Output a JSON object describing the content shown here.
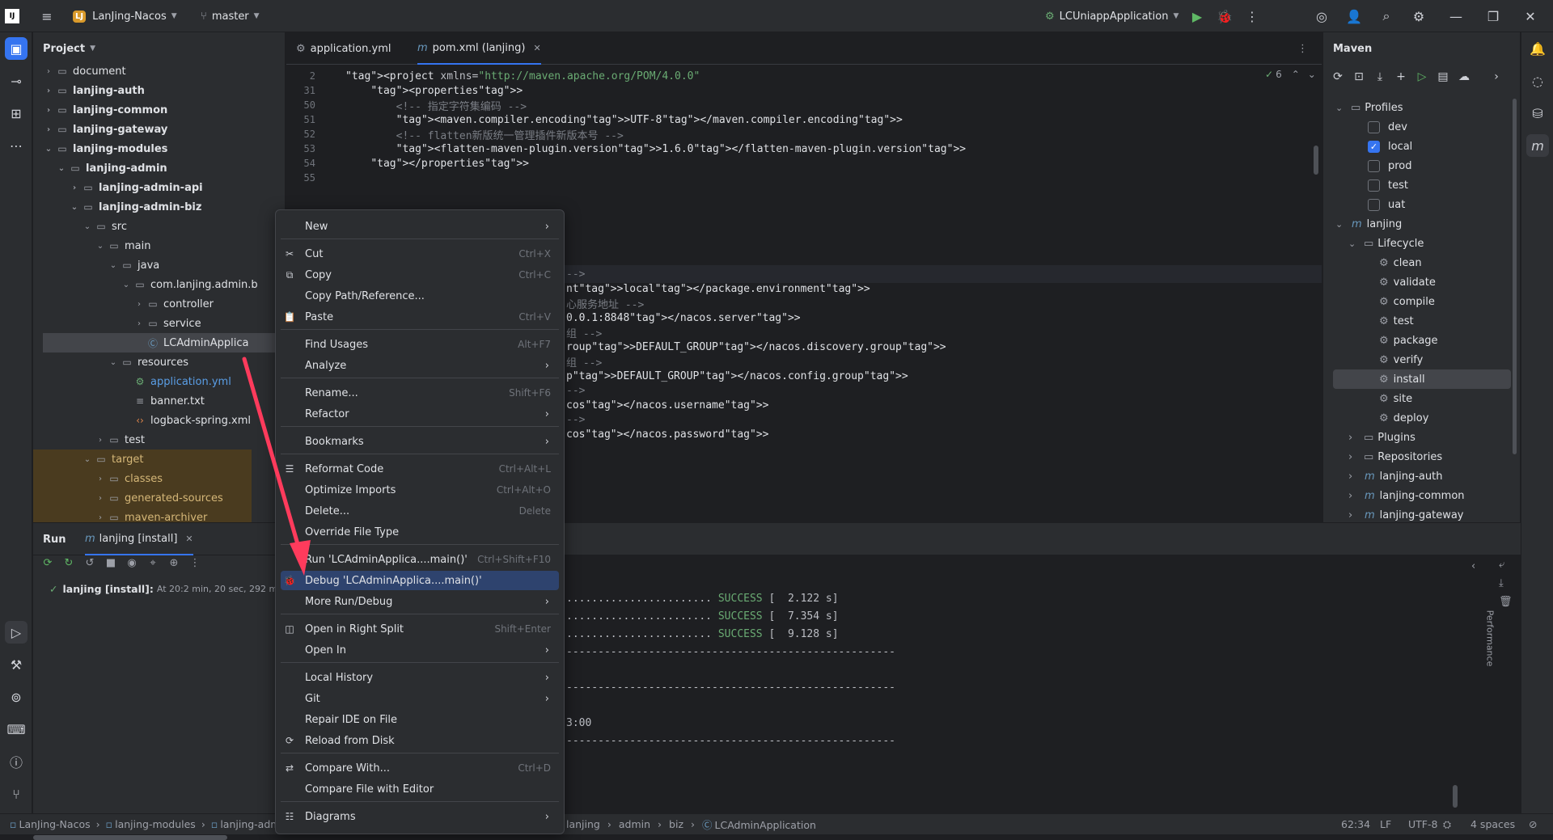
{
  "titlebar": {
    "project_badge": "LJ",
    "project": "LanJing-Nacos",
    "branch": "master",
    "run_config": "LCUniappApplication"
  },
  "project_panel": {
    "title": "Project",
    "tree": [
      {
        "label": "document",
        "bold": false,
        "icon": "folder"
      },
      {
        "label": "lanjing-auth",
        "bold": true,
        "icon": "module"
      },
      {
        "label": "lanjing-common",
        "bold": true,
        "icon": "module"
      },
      {
        "label": "lanjing-gateway",
        "bold": true,
        "icon": "module"
      },
      {
        "label": "lanjing-modules",
        "bold": true,
        "icon": "module"
      },
      {
        "label": "lanjing-admin",
        "bold": true,
        "icon": "module"
      },
      {
        "label": "lanjing-admin-api",
        "bold": true,
        "icon": "module"
      },
      {
        "label": "lanjing-admin-biz",
        "bold": true,
        "icon": "module"
      },
      {
        "label": "src",
        "bold": false,
        "icon": "folder"
      },
      {
        "label": "main",
        "bold": false,
        "icon": "folder"
      },
      {
        "label": "java",
        "bold": false,
        "icon": "folder"
      },
      {
        "label": "com.lanjing.admin.b",
        "bold": false,
        "icon": "package"
      },
      {
        "label": "controller",
        "bold": false,
        "icon": "package"
      },
      {
        "label": "service",
        "bold": false,
        "icon": "package"
      },
      {
        "label": "LCAdminApplica",
        "bold": false,
        "icon": "class"
      },
      {
        "label": "resources",
        "bold": false,
        "icon": "folder"
      },
      {
        "label": "application.yml",
        "bold": false,
        "icon": "yml"
      },
      {
        "label": "banner.txt",
        "bold": false,
        "icon": "text"
      },
      {
        "label": "logback-spring.xml",
        "bold": false,
        "icon": "xml"
      },
      {
        "label": "test",
        "bold": false,
        "icon": "folder"
      },
      {
        "label": "target",
        "bold": false,
        "icon": "folder"
      },
      {
        "label": "classes",
        "bold": false,
        "icon": "folder"
      },
      {
        "label": "generated-sources",
        "bold": false,
        "icon": "folder"
      },
      {
        "label": "maven-archiver",
        "bold": false,
        "icon": "folder"
      }
    ]
  },
  "editor": {
    "tabs": [
      {
        "label": "application.yml"
      },
      {
        "label": "pom.xml (lanjing)"
      }
    ],
    "inspections": "6",
    "lines": [
      {
        "n": "2",
        "t": "<project xmlns=\"http://maven.apache.org/POM/4.0.0\""
      },
      {
        "n": "31",
        "t": "    <properties>"
      },
      {
        "n": "50",
        "t": "        <!-- 指定字符集编码 -->"
      },
      {
        "n": "51",
        "t": "        <maven.compiler.encoding>UTF-8</maven.compiler.encoding>"
      },
      {
        "n": "52",
        "t": "        <!-- flatten新版统一管理插件新版本号 -->"
      },
      {
        "n": "53",
        "t": "        <flatten-maven-plugin.version>1.6.0</flatten-maven-plugin.version>"
      },
      {
        "n": "54",
        "t": "    </properties>"
      },
      {
        "n": "55",
        "t": ""
      }
    ],
    "hidden_lines": [
      "-->",
      "nt>local</package.environment>",
      "心服务地址 -->",
      "0.0.1:8848</nacos.server>",
      "组 -->",
      "roup>DEFAULT_GROUP</nacos.discovery.group>",
      "组 -->",
      "p>DEFAULT_GROUP</nacos.config.group>",
      "-->",
      "cos</nacos.username>",
      "-->",
      "cos</nacos.password>"
    ]
  },
  "maven": {
    "title": "Maven",
    "profiles_label": "Profiles",
    "profiles": [
      {
        "name": "dev",
        "checked": false
      },
      {
        "name": "local",
        "checked": true
      },
      {
        "name": "prod",
        "checked": false
      },
      {
        "name": "test",
        "checked": false
      },
      {
        "name": "uat",
        "checked": false
      }
    ],
    "project": "lanjing",
    "lifecycle_label": "Lifecycle",
    "lifecycle": [
      "clean",
      "validate",
      "compile",
      "test",
      "package",
      "verify",
      "install",
      "site",
      "deploy"
    ],
    "plugins": "Plugins",
    "repositories": "Repositories",
    "modules": [
      "lanjing-auth",
      "lanjing-common",
      "lanjing-gateway"
    ]
  },
  "run": {
    "title": "Run",
    "tab": "lanjing [install]",
    "tree_item": "lanjing [install]:",
    "tree_info": "At 20:2 min, 20 sec, 292 ms",
    "console": [
      {
        "pre": "....................... ",
        "status": "SUCCESS",
        "post": " [  2.122 s]"
      },
      {
        "pre": "....................... ",
        "status": "SUCCESS",
        "post": " [  7.354 s]"
      },
      {
        "pre": "....................... ",
        "status": "SUCCESS",
        "post": " [  9.128 s]"
      },
      {
        "pre": "----------------------------------------------------",
        "status": "",
        "post": ""
      },
      {
        "pre": "",
        "status": "",
        "post": ""
      },
      {
        "pre": "----------------------------------------------------",
        "status": "",
        "post": ""
      },
      {
        "pre": "",
        "status": "",
        "post": ""
      },
      {
        "pre": "3:00",
        "status": "",
        "post": ""
      },
      {
        "pre": "----------------------------------------------------",
        "status": "",
        "post": ""
      }
    ],
    "performance": "Performance"
  },
  "statusbar": {
    "crumbs": [
      "LanJing-Nacos",
      "lanjing-modules",
      "lanjing-adm"
    ],
    "crumbs2": [
      "lanjing",
      "admin",
      "biz",
      "LCAdminApplication"
    ],
    "position": "62:34",
    "line_sep": "LF",
    "encoding": "UTF-8",
    "indent": "4 spaces"
  },
  "context_menu": {
    "items": [
      {
        "label": "New",
        "shortcut": "",
        "sub": true,
        "icon": "",
        "sep_before": false
      },
      {
        "label": "Cut",
        "shortcut": "Ctrl+X",
        "sub": false,
        "icon": "✂",
        "sep_before": true
      },
      {
        "label": "Copy",
        "shortcut": "Ctrl+C",
        "sub": false,
        "icon": "⧉",
        "sep_before": false
      },
      {
        "label": "Copy Path/Reference...",
        "shortcut": "",
        "sub": false,
        "icon": "",
        "sep_before": false
      },
      {
        "label": "Paste",
        "shortcut": "Ctrl+V",
        "sub": false,
        "icon": "📋",
        "sep_before": false
      },
      {
        "label": "Find Usages",
        "shortcut": "Alt+F7",
        "sub": false,
        "icon": "",
        "sep_before": true
      },
      {
        "label": "Analyze",
        "shortcut": "",
        "sub": true,
        "icon": "",
        "sep_before": false
      },
      {
        "label": "Rename...",
        "shortcut": "Shift+F6",
        "sub": false,
        "icon": "",
        "sep_before": true
      },
      {
        "label": "Refactor",
        "shortcut": "",
        "sub": true,
        "icon": "",
        "sep_before": false
      },
      {
        "label": "Bookmarks",
        "shortcut": "",
        "sub": true,
        "icon": "",
        "sep_before": true
      },
      {
        "label": "Reformat Code",
        "shortcut": "Ctrl+Alt+L",
        "sub": false,
        "icon": "☰",
        "sep_before": true
      },
      {
        "label": "Optimize Imports",
        "shortcut": "Ctrl+Alt+O",
        "sub": false,
        "icon": "",
        "sep_before": false
      },
      {
        "label": "Delete...",
        "shortcut": "Delete",
        "sub": false,
        "icon": "",
        "sep_before": false
      },
      {
        "label": "Override File Type",
        "shortcut": "",
        "sub": false,
        "icon": "",
        "sep_before": false
      },
      {
        "label": "Run 'LCAdminApplica....main()'",
        "shortcut": "Ctrl+Shift+F10",
        "sub": false,
        "icon": "",
        "sep_before": true
      },
      {
        "label": "Debug 'LCAdminApplica....main()'",
        "shortcut": "",
        "sub": false,
        "icon": "🐞",
        "sep_before": false,
        "selected": true
      },
      {
        "label": "More Run/Debug",
        "shortcut": "",
        "sub": true,
        "icon": "",
        "sep_before": false
      },
      {
        "label": "Open in Right Split",
        "shortcut": "Shift+Enter",
        "sub": false,
        "icon": "◫",
        "sep_before": true
      },
      {
        "label": "Open In",
        "shortcut": "",
        "sub": true,
        "icon": "",
        "sep_before": false
      },
      {
        "label": "Local History",
        "shortcut": "",
        "sub": true,
        "icon": "",
        "sep_before": true
      },
      {
        "label": "Git",
        "shortcut": "",
        "sub": true,
        "icon": "",
        "sep_before": false
      },
      {
        "label": "Repair IDE on File",
        "shortcut": "",
        "sub": false,
        "icon": "",
        "sep_before": false
      },
      {
        "label": "Reload from Disk",
        "shortcut": "",
        "sub": false,
        "icon": "⟳",
        "sep_before": false
      },
      {
        "label": "Compare With...",
        "shortcut": "Ctrl+D",
        "sub": false,
        "icon": "⇄",
        "sep_before": true
      },
      {
        "label": "Compare File with Editor",
        "shortcut": "",
        "sub": false,
        "icon": "",
        "sep_before": false
      },
      {
        "label": "Diagrams",
        "shortcut": "",
        "sub": true,
        "icon": "☷",
        "sep_before": true
      }
    ]
  },
  "colors": {
    "accent": "#3574f0",
    "arrow": "#ff3b5c",
    "success": "#6aab73"
  }
}
